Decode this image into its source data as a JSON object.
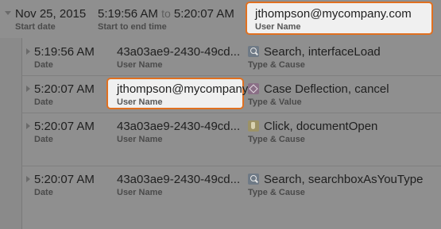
{
  "header": {
    "start_date": "Nov 25, 2015",
    "start_date_label": "Start date",
    "start_time": "5:19:56 AM",
    "to_word": "to",
    "end_time": "5:20:07 AM",
    "range_label": "Start to end time",
    "user_name": "jthompson@mycompany.com",
    "user_name_label": "User Name"
  },
  "rows": [
    {
      "time": "5:19:56 AM",
      "time_label": "Date",
      "user": "43a03ae9-2430-49cd...",
      "user_label": "User Name",
      "event": "Search, interfaceLoad",
      "event_label": "Type & Cause",
      "icon": "search-icon"
    },
    {
      "time": "5:20:07 AM",
      "time_label": "Date",
      "user": "jthompson@mycompany...",
      "user_label": "User Name",
      "event": "Case Deflection, cancel",
      "event_label": "Type & Value",
      "icon": "case-deflection-icon"
    },
    {
      "time": "5:20:07 AM",
      "time_label": "Date",
      "user": "43a03ae9-2430-49cd...",
      "user_label": "User Name",
      "event": "Click, documentOpen",
      "event_label": "Type & Cause",
      "icon": "click-icon"
    },
    {
      "time": "5:20:07 AM",
      "time_label": "Date",
      "user": "43a03ae9-2430-49cd...",
      "user_label": "User Name",
      "event": "Search, searchboxAsYouType",
      "event_label": "Type & Cause",
      "icon": "search-icon"
    }
  ],
  "colors": {
    "highlight_border": "#e07020",
    "overlay": "#8f8f8f"
  }
}
